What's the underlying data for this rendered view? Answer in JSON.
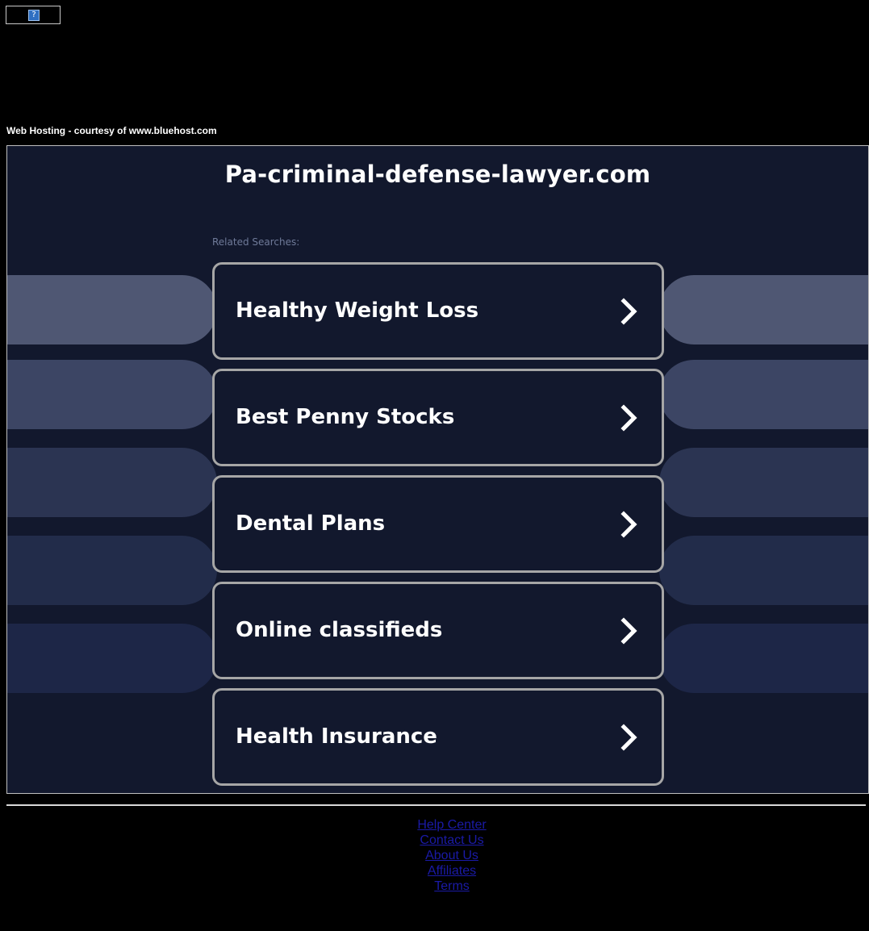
{
  "top_widget": {
    "glyph": "?"
  },
  "hosting_note": "Web Hosting - courtesy of www.bluehost.com",
  "site_title": "Pa-criminal-defense-lawyer.com",
  "related_label": "Related Searches:",
  "results": [
    {
      "label": "Healthy Weight Loss"
    },
    {
      "label": "Best Penny Stocks"
    },
    {
      "label": "Dental Plans"
    },
    {
      "label": "Online classifieds"
    },
    {
      "label": "Health Insurance"
    }
  ],
  "footer": {
    "links": [
      "Help Center",
      "Contact Us",
      "About Us",
      "Affiliates",
      "Terms"
    ]
  },
  "colors": {
    "background": "#000000",
    "frame_background": "#12182d",
    "button_border": "#a6a6a6",
    "link": "#1a1aa6",
    "muted_label": "#6f7a99"
  },
  "icons": {
    "result_arrow": "chevron-right-icon",
    "top_widget": "help-question-icon"
  }
}
